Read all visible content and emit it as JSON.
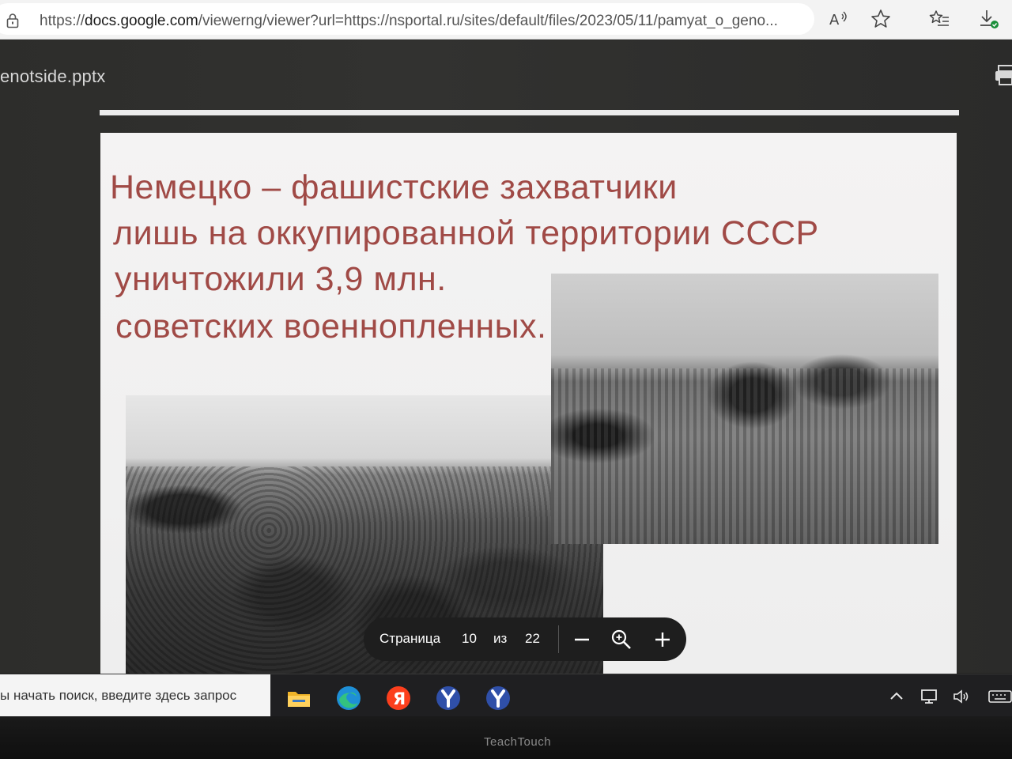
{
  "browser": {
    "url_prefix": "https://",
    "url_host": "docs.google.com",
    "url_rest": "/viewerng/viewer?url=https://nsportal.ru/sites/default/files/2023/05/11/pamyat_o_geno..."
  },
  "viewer": {
    "file_name": "enotside.pptx"
  },
  "slide": {
    "heading_lines": [
      "Немецко – фашистские захватчики",
      "лишь на оккупированной территории СССР",
      "уничтожили 3,9 млн.",
      "советских военнопленных."
    ],
    "heading_color": "#a04a46"
  },
  "pager": {
    "page_label": "Страница",
    "current_page": "10",
    "of_label": "из",
    "total_pages": "22"
  },
  "taskbar": {
    "search_placeholder": "ы начать поиск, введите здесь запрос",
    "apps": [
      "file-explorer-icon",
      "edge-icon",
      "yandex-icon",
      "yandex-browser-icon",
      "yandex-browser-icon"
    ]
  },
  "monitor": {
    "brand": "TeachTouch"
  }
}
